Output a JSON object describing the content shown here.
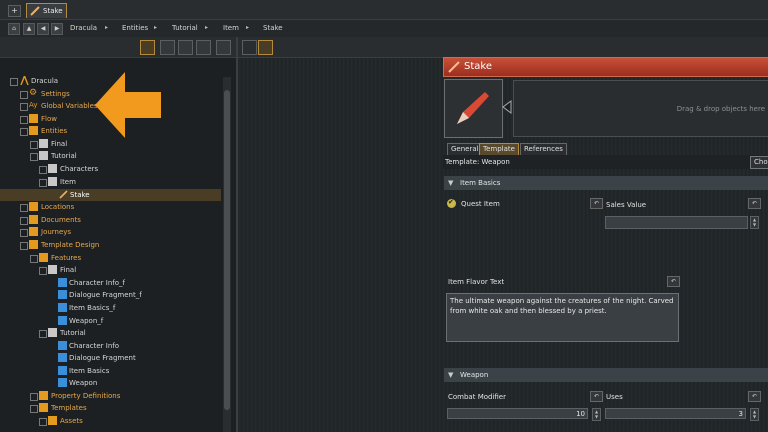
{
  "tabbar": {
    "plus": "+",
    "doc_tab": "Stake"
  },
  "breadcrumb": {
    "items": [
      "Dracula",
      "Entities",
      "Tutorial",
      "Item",
      "Stake"
    ]
  },
  "tree": {
    "root": "Dracula",
    "settings": "Settings",
    "global_variables": "Global Variables",
    "flow": "Flow",
    "entities": "Entities",
    "final": "Final",
    "tutorial": "Tutorial",
    "characters": "Characters",
    "item": "Item",
    "stake": "Stake",
    "locations": "Locations",
    "documents": "Documents",
    "journeys": "Journeys",
    "template_design": "Template Design",
    "features": "Features",
    "features_final": "Final",
    "character_info_f": "Character Info_f",
    "dialogue_fragment_f": "Dialogue Fragment_f",
    "item_basics_f": "Item Basics_f",
    "weapon_f": "Weapon_f",
    "features_tutorial": "Tutorial",
    "character_info": "Character Info",
    "dialogue_fragment": "Dialogue Fragment",
    "item_basics": "Item Basics",
    "weapon": "Weapon",
    "property_definitions": "Property Definitions",
    "templates": "Templates",
    "assets": "Assets"
  },
  "object": {
    "title": "Stake",
    "dropzone": "Drag & drop objects here",
    "tabs": [
      "General",
      "Template",
      "References"
    ],
    "active_tab": "Template",
    "template_label": "Template: Weapon",
    "choose_label": "Cho"
  },
  "item_basics": {
    "header": "Item Basics",
    "quest_item_label": "Quest Item",
    "quest_item_checked": true,
    "sales_value_label": "Sales Value",
    "sales_value": "",
    "flavor_label": "Item Flavor Text",
    "flavor_text": "The ultimate weapon against the creatures of the night. Carved from white oak and then blessed by a priest."
  },
  "weapon_section": {
    "header": "Weapon",
    "combat_modifier_label": "Combat Modifier",
    "combat_modifier": "10",
    "uses_label": "Uses",
    "uses": "3"
  },
  "colors": {
    "accent": "#e8951c",
    "header_red": "#b23a26",
    "selection": "#4a3d25",
    "folder": "#e49a1f"
  }
}
